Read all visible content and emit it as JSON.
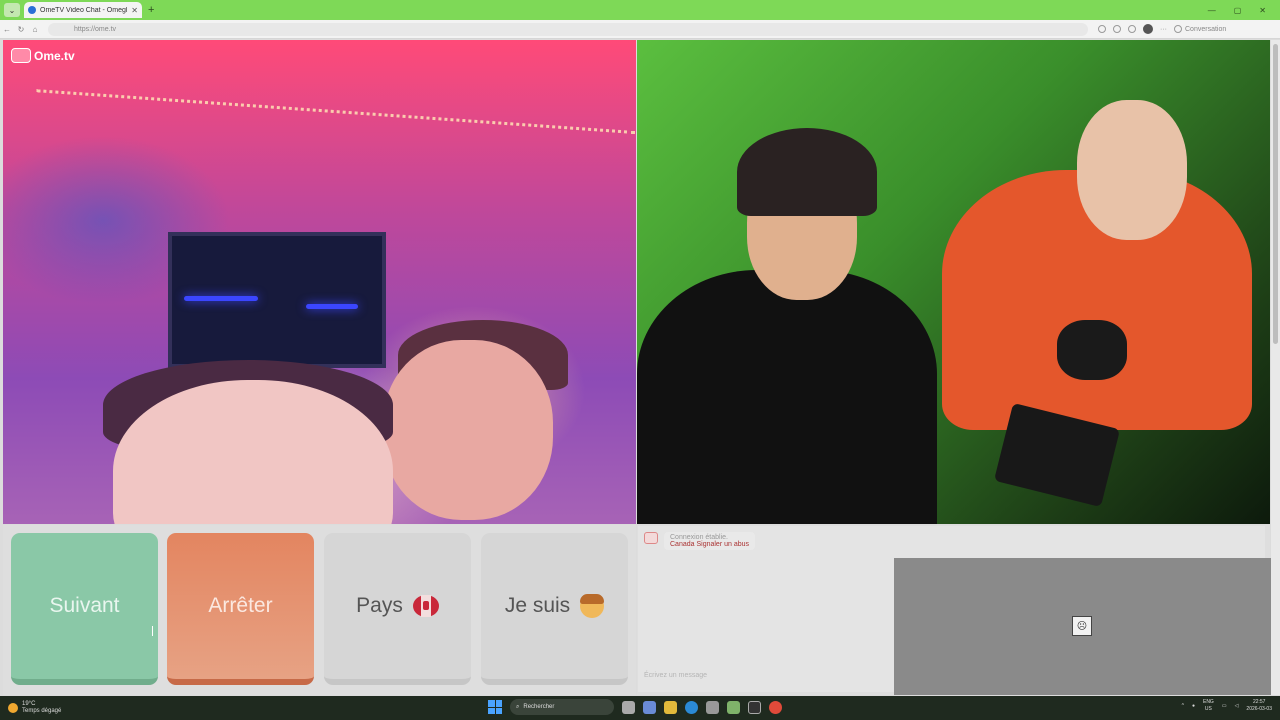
{
  "browser": {
    "tab_title": "OmeTV Video Chat - Omegl",
    "tab_close": "✕",
    "new_tab": "+",
    "window_controls": [
      "—",
      "▢",
      "✕"
    ],
    "url": "https://ome.tv",
    "conversation_label": "Conversation"
  },
  "site": {
    "logo_text": "Ome.tv"
  },
  "controls": {
    "next_label": "Suivant",
    "stop_label": "Arrêter",
    "country_label": "Pays",
    "country_flag": "canada-flag-icon",
    "gender_label": "Je suis",
    "gender_icon": "boy-emoji-icon"
  },
  "chat": {
    "system_message_line1": "Connexion établie.",
    "system_message_line2": "Canada Signaler un abus",
    "input_placeholder": "Écrivez un message"
  },
  "taskbar": {
    "weather_temp": "19°C",
    "weather_desc": "Temps dégagé",
    "search_label": "Rechercher",
    "lang_top": "ENG",
    "lang_bottom": "US",
    "time": "22:57",
    "date": "2026-03-03"
  },
  "colors": {
    "tabbar_bg": "#7ed957",
    "next_btn": "#8ac8a7",
    "stop_btn": "#e38560",
    "neutral_btn": "#d6d6d6",
    "taskbar_bg": "#1f2a1f"
  }
}
